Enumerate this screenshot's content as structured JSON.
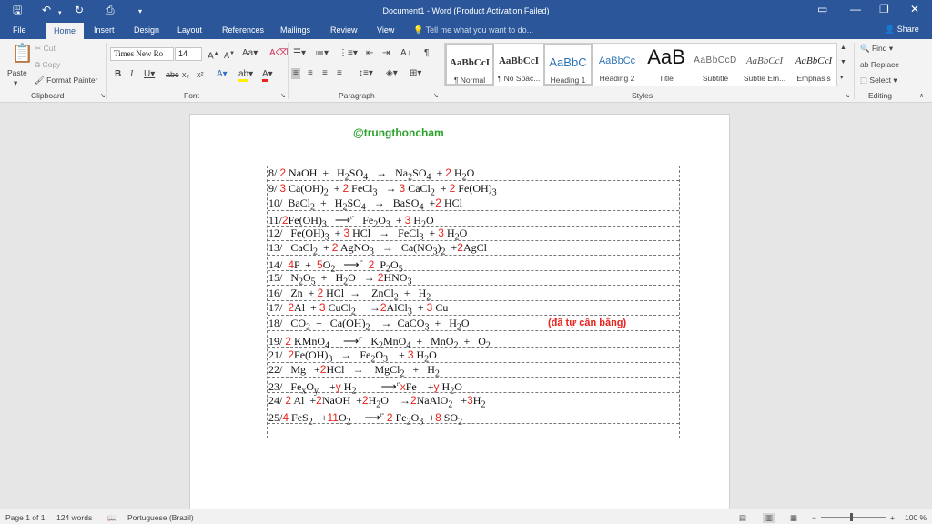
{
  "window": {
    "title": "Document1 - Word (Product Activation Failed)"
  },
  "tabs": [
    "File",
    "Home",
    "Insert",
    "Design",
    "Layout",
    "References",
    "Mailings",
    "Review",
    "View"
  ],
  "tell_me": "Tell me what you want to do...",
  "share": "Share",
  "clipboard": {
    "paste": "Paste",
    "cut": "Cut",
    "copy": "Copy",
    "format_painter": "Format Painter",
    "label": "Clipboard"
  },
  "font": {
    "name": "Times New Ro",
    "size": "14",
    "label": "Font"
  },
  "paragraph": {
    "label": "Paragraph"
  },
  "styles": {
    "label": "Styles",
    "items": [
      {
        "preview": "AaBbCcI",
        "name": "¶ Normal"
      },
      {
        "preview": "AaBbCcI",
        "name": "¶ No Spac..."
      },
      {
        "preview": "AaBbC",
        "name": "Heading 1"
      },
      {
        "preview": "AaBbCc",
        "name": "Heading 2"
      },
      {
        "preview": "AaB",
        "name": "Title"
      },
      {
        "preview": "AaBbCcD",
        "name": "Subtitle"
      },
      {
        "preview": "AaBbCcI",
        "name": "Subtle Em..."
      },
      {
        "preview": "AaBbCcI",
        "name": "Emphasis"
      }
    ]
  },
  "editing": {
    "find": "Find",
    "replace": "Replace",
    "select": "Select",
    "label": "Editing"
  },
  "document": {
    "handle": "@trungthoncham",
    "note": "(đã tự cân bằng)"
  },
  "status": {
    "page": "Page 1 of 1",
    "words": "124 words",
    "language": "Portuguese (Brazil)",
    "zoom": "100 %"
  }
}
